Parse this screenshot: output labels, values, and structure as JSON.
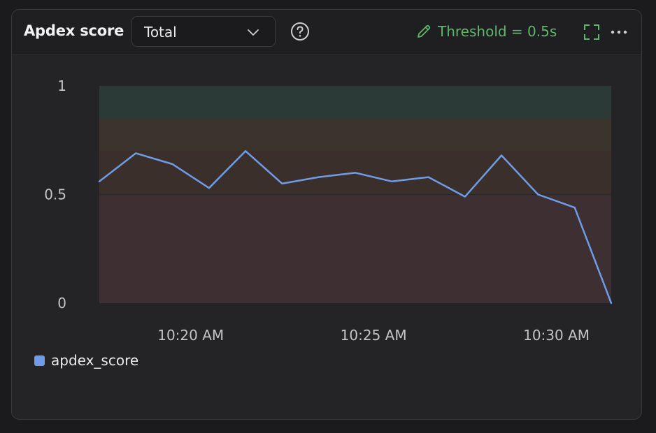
{
  "header": {
    "title": "Apdex score",
    "select_value": "Total",
    "threshold_label": "Threshold = 0.5s",
    "help_icon": "question-circle-icon",
    "edit_icon": "pencil-icon",
    "fullscreen_icon": "expand-icon",
    "more_icon": "more-dots-icon",
    "threshold_color": "#5fb86a"
  },
  "chart_data": {
    "type": "line",
    "x": [
      "10:17",
      "10:18",
      "10:19",
      "10:20",
      "10:21",
      "10:22",
      "10:23",
      "10:24",
      "10:25",
      "10:26",
      "10:27",
      "10:28",
      "10:29",
      "10:30",
      "10:31",
      "10:32"
    ],
    "series": [
      {
        "name": "apdex_score",
        "color": "#6f9ce6",
        "values": [
          0.56,
          0.69,
          0.64,
          0.53,
          0.7,
          0.55,
          0.58,
          0.6,
          0.56,
          0.58,
          0.49,
          0.68,
          0.5,
          0.44,
          0.0,
          0.0
        ]
      }
    ],
    "x_ticks": [
      "10:20 AM",
      "10:25 AM",
      "10:30 AM"
    ],
    "y_ticks": [
      "1",
      "0.5",
      "0"
    ],
    "ylim": [
      0,
      1
    ],
    "bands": [
      {
        "from": 0.0,
        "to": 0.5,
        "color": "#3d2f32"
      },
      {
        "from": 0.5,
        "to": 0.7,
        "color": "#3b2f2b"
      },
      {
        "from": 0.7,
        "to": 0.85,
        "color": "#3a342c"
      },
      {
        "from": 0.85,
        "to": 1.0,
        "color": "#2b3a36"
      }
    ],
    "legend_position": "bottom-left",
    "grid": true
  }
}
